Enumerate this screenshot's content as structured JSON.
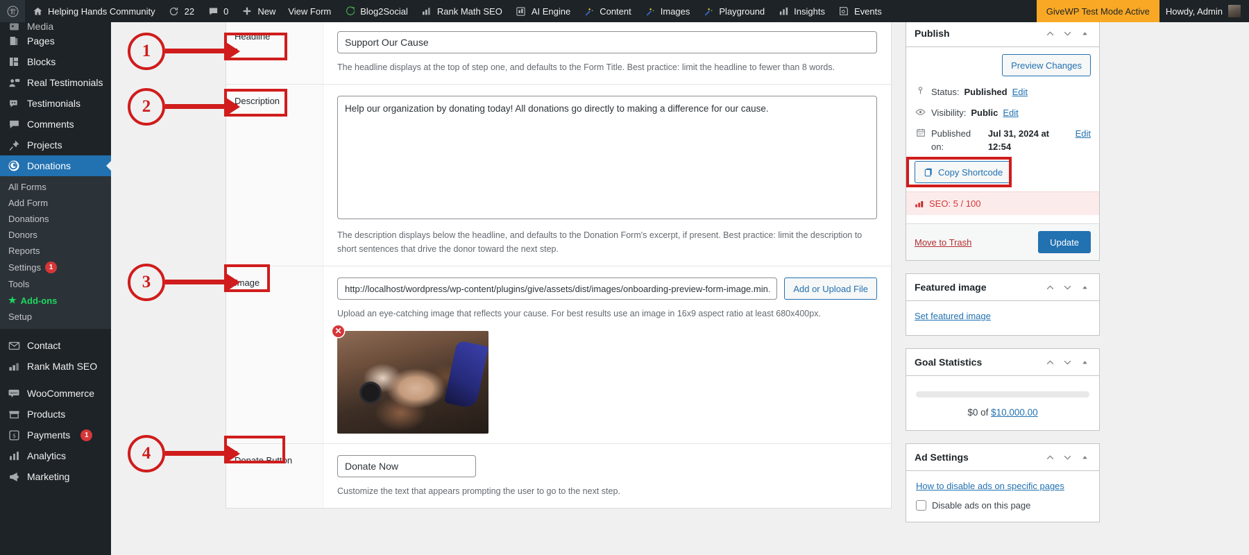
{
  "adminbar": {
    "items": [
      {
        "icon": "wordpress-logo-icon",
        "label": ""
      },
      {
        "icon": "home-icon",
        "label": "Helping Hands Community"
      },
      {
        "icon": "update-icon",
        "label": "22"
      },
      {
        "icon": "comment-bubble-icon",
        "label": "0"
      },
      {
        "icon": "plus-icon",
        "label": "New"
      },
      {
        "icon": "",
        "label": "View Form"
      },
      {
        "icon": "blog2social-icon",
        "label": "Blog2Social"
      },
      {
        "icon": "rankmath-icon",
        "label": "Rank Math SEO"
      },
      {
        "icon": "ai-engine-icon",
        "label": "AI Engine"
      },
      {
        "icon": "magic-wand-icon",
        "label": "Content"
      },
      {
        "icon": "magic-wand-icon",
        "label": "Images"
      },
      {
        "icon": "magic-wand-icon",
        "label": "Playground"
      },
      {
        "icon": "bar-chart-icon",
        "label": "Insights"
      },
      {
        "icon": "events-icon",
        "label": "Events"
      }
    ],
    "givewp_notice": "GiveWP Test Mode Active",
    "howdy": "Howdy, Admin"
  },
  "sidebar": {
    "items": [
      {
        "label": "Media",
        "icon": "media-icon",
        "current": false,
        "partial": true
      },
      {
        "label": "Pages",
        "icon": "pages-icon",
        "current": false
      },
      {
        "label": "Blocks",
        "icon": "blocks-icon",
        "current": false
      },
      {
        "label": "Real Testimonials",
        "icon": "real-testimonials-icon",
        "current": false
      },
      {
        "label": "Testimonials",
        "icon": "testimonials-icon",
        "current": false
      },
      {
        "label": "Comments",
        "icon": "comments-icon",
        "current": false
      },
      {
        "label": "Projects",
        "icon": "projects-pin-icon",
        "current": false
      },
      {
        "label": "Donations",
        "icon": "donations-icon",
        "current": true
      }
    ],
    "submenu": [
      {
        "label": "All Forms",
        "badge": null
      },
      {
        "label": "Add Form",
        "badge": null
      },
      {
        "label": "Donations",
        "badge": null
      },
      {
        "label": "Donors",
        "badge": null
      },
      {
        "label": "Reports",
        "badge": null
      },
      {
        "label": "Settings",
        "badge": "1"
      },
      {
        "label": "Tools",
        "badge": null
      },
      {
        "label": "Add-ons",
        "badge": null,
        "highlight": true
      },
      {
        "label": "Setup",
        "badge": null
      }
    ],
    "items_after": [
      {
        "label": "Contact",
        "icon": "envelope-icon",
        "badge": null
      },
      {
        "label": "Rank Math SEO",
        "icon": "rankmath-icon",
        "badge": null
      },
      {
        "label": "WooCommerce",
        "icon": "woocommerce-icon",
        "badge": null
      },
      {
        "label": "Products",
        "icon": "products-icon",
        "badge": null
      },
      {
        "label": "Payments",
        "icon": "payments-icon",
        "badge": "1"
      },
      {
        "label": "Analytics",
        "icon": "analytics-icon",
        "badge": null
      },
      {
        "label": "Marketing",
        "icon": "marketing-megaphone-icon",
        "badge": null
      }
    ]
  },
  "form": {
    "headline": {
      "label": "Headline",
      "value": "Support Our Cause",
      "helper": "The headline displays at the top of step one, and defaults to the Form Title. Best practice: limit the headline to fewer than 8 words."
    },
    "description": {
      "label": "Description",
      "value": "Help our organization by donating today! All donations go directly to making a difference for our cause.",
      "helper": "The description displays below the headline, and defaults to the Donation Form's excerpt, if present. Best practice: limit the description to short sentences that drive the donor toward the next step."
    },
    "image": {
      "label": "Image",
      "value": "http://localhost/wordpress/wp-content/plugins/give/assets/dist/images/onboarding-preview-form-image.min.jpg",
      "upload_button": "Add or Upload File",
      "helper": "Upload an eye-catching image that reflects your cause. For best results use an image in 16x9 aspect ratio at least 680x400px.",
      "remove_label": "✕"
    },
    "donate_button": {
      "label": "Donate Button",
      "value": "Donate Now",
      "helper": "Customize the text that appears prompting the user to go to the next step."
    }
  },
  "annotations": [
    {
      "number": "1",
      "target": "Headline"
    },
    {
      "number": "2",
      "target": "Description"
    },
    {
      "number": "3",
      "target": "Image"
    },
    {
      "number": "4",
      "target": "Donate Button"
    }
  ],
  "publish": {
    "title": "Publish",
    "preview_changes": "Preview Changes",
    "status_label": "Status:",
    "status_value": "Published",
    "status_edit": "Edit",
    "visibility_label": "Visibility:",
    "visibility_value": "Public",
    "visibility_edit": "Edit",
    "published_label": "Published on:",
    "published_value": "Jul 31, 2024 at 12:54",
    "published_edit": "Edit",
    "copy_shortcode": "Copy Shortcode",
    "seo_text": "SEO: 5 / 100",
    "move_to_trash": "Move to Trash",
    "update": "Update"
  },
  "featured_image": {
    "title": "Featured image",
    "set_link": "Set featured image"
  },
  "goal_statistics": {
    "title": "Goal Statistics",
    "progress_percent": 0,
    "amount_prefix": "$0 of",
    "goal_amount": "$10,000.00"
  },
  "ad_settings": {
    "title": "Ad Settings",
    "help_link": "How to disable ads on specific pages",
    "checkbox_label": "Disable ads on this page"
  },
  "colors": {
    "admin_bar": "#1d2327",
    "accent_blue": "#2271b1",
    "annotation_red": "#d01c1c",
    "givewp_yellow": "#f9a825",
    "badge_red": "#d63638"
  }
}
